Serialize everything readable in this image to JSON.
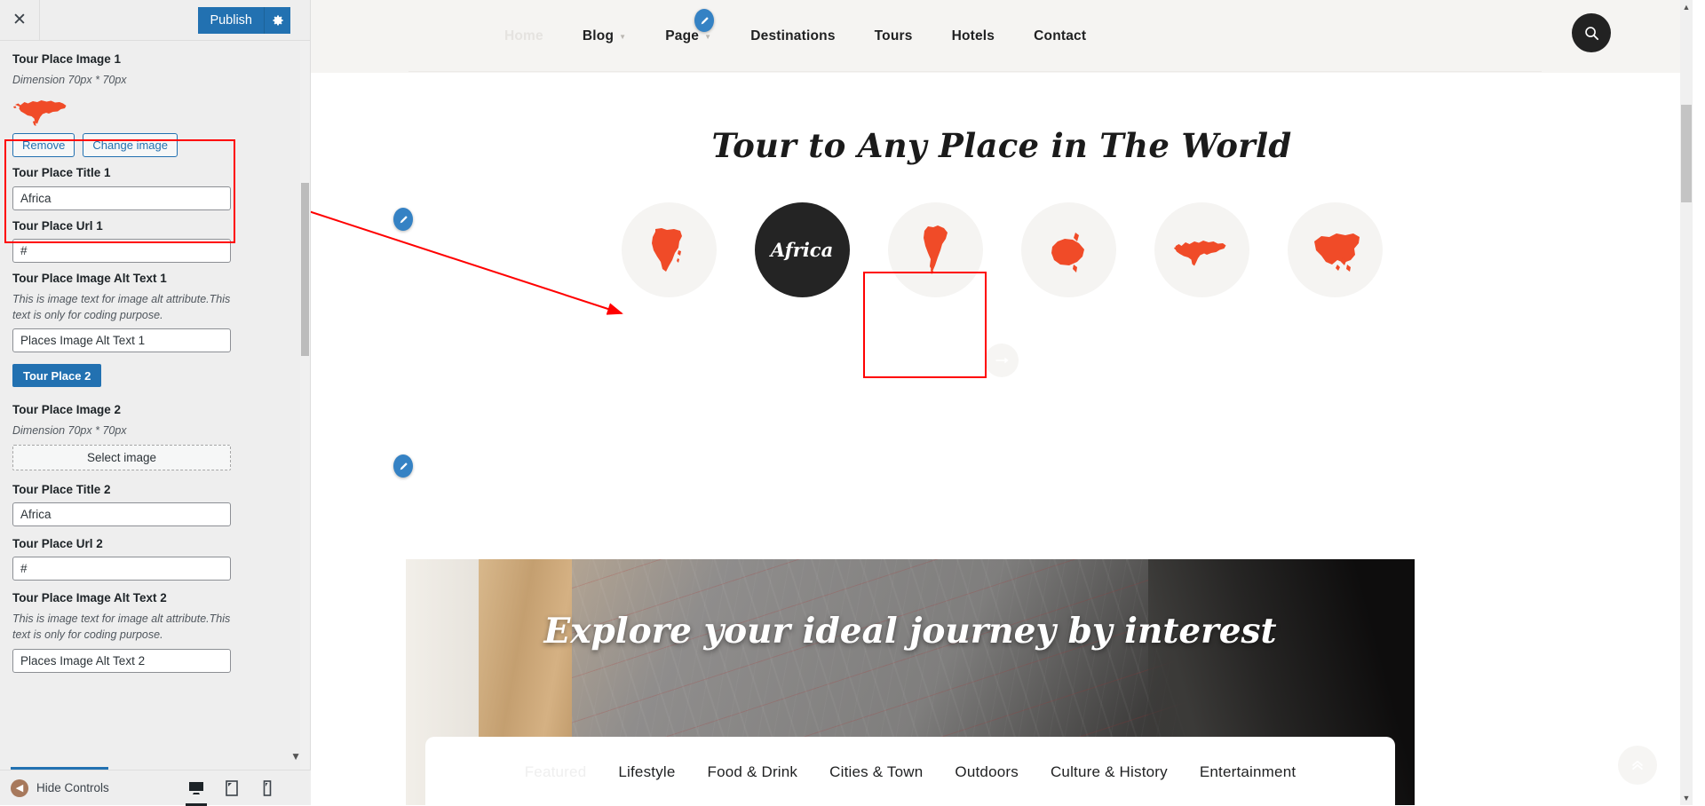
{
  "customizer": {
    "close_icon": "close-icon",
    "publish_label": "Publish",
    "gear_icon": "gear-icon",
    "controls": [
      {
        "title": "Tour Place Image 1",
        "desc": "Dimension 70px * 70px",
        "remove_label": "Remove",
        "change_label": "Change image"
      },
      {
        "title": "Tour Place Title 1",
        "value": "Africa"
      },
      {
        "title": "Tour Place Url 1",
        "value": "#"
      },
      {
        "title": "Tour Place Image Alt Text 1",
        "desc": "This is image text for image alt attribute.This text is only for coding purpose.",
        "value": "Places Image Alt Text 1"
      },
      {
        "button_label": "Tour Place 2"
      },
      {
        "title": "Tour Place Image 2",
        "desc": "Dimension 70px * 70px",
        "select_label": "Select image"
      },
      {
        "title": "Tour Place Title 2",
        "value": "Africa"
      },
      {
        "title": "Tour Place Url 2",
        "value": "#"
      },
      {
        "title": "Tour Place Image Alt Text 2",
        "desc": "This is image text for image alt attribute.This text is only for coding purpose.",
        "value": "Places Image Alt Text 2"
      }
    ],
    "footer": {
      "hide_controls_label": "Hide Controls",
      "devices": [
        "desktop-icon",
        "tablet-icon",
        "mobile-icon"
      ]
    }
  },
  "preview": {
    "nav": [
      {
        "label": "Home",
        "muted": true,
        "caret": false
      },
      {
        "label": "Blog",
        "muted": false,
        "caret": true
      },
      {
        "label": "Page",
        "muted": false,
        "caret": true
      },
      {
        "label": "Destinations",
        "muted": false,
        "caret": false
      },
      {
        "label": "Tours",
        "muted": false,
        "caret": false
      },
      {
        "label": "Hotels",
        "muted": false,
        "caret": false
      },
      {
        "label": "Contact",
        "muted": false,
        "caret": false
      }
    ],
    "search_icon": "search-icon",
    "tour_heading": "Tour to Any Place in The World",
    "places": [
      {
        "name": "Africa",
        "active": false
      },
      {
        "name": "Africa",
        "active": true
      },
      {
        "name": "South America",
        "active": false
      },
      {
        "name": "Australia",
        "active": false
      },
      {
        "name": "Europe",
        "active": false
      },
      {
        "name": "Asia",
        "active": false
      }
    ],
    "next_arrow_icon": "arrow-right-icon",
    "explore_title": "Explore your ideal journey by interest",
    "tabs": [
      {
        "label": "Featured",
        "muted": true
      },
      {
        "label": "Lifestyle",
        "muted": false
      },
      {
        "label": "Food & Drink",
        "muted": false
      },
      {
        "label": "Cities & Town",
        "muted": false
      },
      {
        "label": "Outdoors",
        "muted": false
      },
      {
        "label": "Culture & History",
        "muted": false
      },
      {
        "label": "Entertainment",
        "muted": false
      }
    ],
    "back_to_top_icon": "chevron-double-up-icon"
  },
  "colors": {
    "accent": "#f04b28",
    "wp_blue": "#2271b1",
    "highlight_red": "#ff0000",
    "dark": "#242424"
  }
}
